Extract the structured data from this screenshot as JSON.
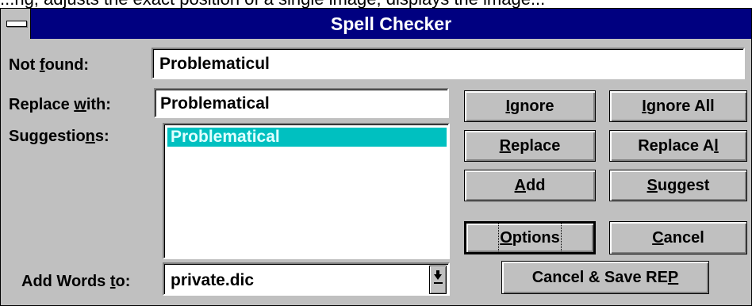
{
  "background_text": "...ng, adjusts the exact position of a single image, displays the image...",
  "window": {
    "title": "Spell Checker"
  },
  "fields": {
    "not_found_label_pre": "Not ",
    "not_found_label_u": "f",
    "not_found_label_post": "ound:",
    "not_found_value": "Problematicul",
    "replace_label_pre": "Replace ",
    "replace_label_u": "w",
    "replace_label_post": "ith:",
    "replace_value": "Problematical",
    "suggestions_label_pre": "Suggestio",
    "suggestions_label_u": "n",
    "suggestions_label_post": "s:",
    "suggestions": [
      "Problematical"
    ],
    "add_words_label_pre": "Add Words ",
    "add_words_label_u": "t",
    "add_words_label_post": "o:",
    "dictionary_value": "private.dic"
  },
  "buttons": {
    "ignore_u": "I",
    "ignore_rest": "gnore",
    "ignore_all_u": "I",
    "ignore_all_rest": "gnore All",
    "replace_u": "R",
    "replace_rest": "eplace",
    "replace_all_pre": "Replace A",
    "replace_all_u": "l",
    "replace_all_post": "",
    "add_u": "A",
    "add_rest": "dd",
    "suggest_u": "S",
    "suggest_rest": "uggest",
    "options_u": "O",
    "options_rest": "ptions",
    "cancel_u": "C",
    "cancel_rest": "ancel",
    "cancel_save_pre": "Cancel & Save RE",
    "cancel_save_u": "P"
  },
  "colors": {
    "title_bar": "#000080",
    "selection": "#00c0c0",
    "face": "#c0c0c0"
  },
  "icons": {
    "system_menu": "system-menu-icon",
    "dropdown": "dropdown-arrow-icon"
  }
}
